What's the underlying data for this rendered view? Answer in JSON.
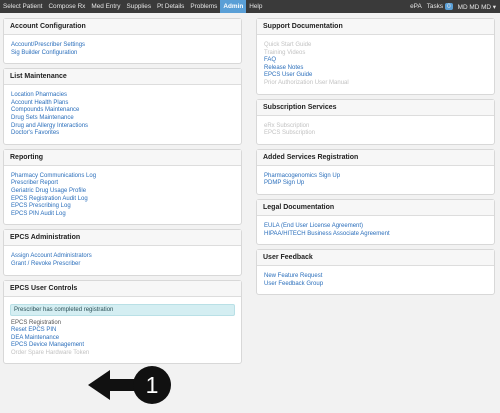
{
  "topnav": {
    "items": [
      {
        "label": "Select Patient",
        "active": false
      },
      {
        "label": "Compose Rx",
        "active": false
      },
      {
        "label": "Med Entry",
        "active": false
      },
      {
        "label": "Supplies",
        "active": false
      },
      {
        "label": "Pt Details",
        "active": false
      },
      {
        "label": "Problems",
        "active": false
      },
      {
        "label": "Admin",
        "active": true
      },
      {
        "label": "Help",
        "active": false
      }
    ],
    "epa": "ePA",
    "tasks_label": "Tasks",
    "tasks_count": "0",
    "user_menu": "MD MD MD ▾"
  },
  "left_panels": [
    {
      "title": "Account Configuration",
      "links": [
        {
          "label": "Account/Prescriber Settings",
          "state": "link"
        },
        {
          "label": "Sig Builder Configuration",
          "state": "link"
        }
      ]
    },
    {
      "title": "List Maintenance",
      "links": [
        {
          "label": "Location Pharmacies",
          "state": "link"
        },
        {
          "label": "Account Health Plans",
          "state": "link"
        },
        {
          "label": "Compounds Maintenance",
          "state": "link"
        },
        {
          "label": "Drug Sets Maintenance",
          "state": "link"
        },
        {
          "label": "Drug and Allergy Interactions",
          "state": "link"
        },
        {
          "label": "Doctor's Favorites",
          "state": "link"
        }
      ]
    },
    {
      "title": "Reporting",
      "links": [
        {
          "label": "Pharmacy Communications Log",
          "state": "link"
        },
        {
          "label": "Prescriber Report",
          "state": "link"
        },
        {
          "label": "Geriatric Drug Usage Profile",
          "state": "link"
        },
        {
          "label": "EPCS Registration Audit Log",
          "state": "link"
        },
        {
          "label": "EPCS Prescribing Log",
          "state": "link"
        },
        {
          "label": "EPCS PIN Audit Log",
          "state": "link"
        }
      ]
    },
    {
      "title": "EPCS Administration",
      "links": [
        {
          "label": "Assign Account Administrators",
          "state": "link"
        },
        {
          "label": "Grant / Revoke Prescriber",
          "state": "link"
        }
      ]
    },
    {
      "title": "EPCS User Controls",
      "notice": "Prescriber has completed registration",
      "links": [
        {
          "label": "EPCS Registration",
          "state": "plain"
        },
        {
          "label": "Reset EPCS PIN",
          "state": "link"
        },
        {
          "label": "DEA Maintenance",
          "state": "link"
        },
        {
          "label": "EPCS Device Management",
          "state": "link"
        },
        {
          "label": "Order Spare Hardware Token",
          "state": "muted"
        }
      ]
    }
  ],
  "right_panels": [
    {
      "title": "Support Documentation",
      "links": [
        {
          "label": "Quick Start Guide",
          "state": "muted"
        },
        {
          "label": "Training Videos",
          "state": "muted"
        },
        {
          "label": "FAQ",
          "state": "link"
        },
        {
          "label": "Release Notes",
          "state": "link"
        },
        {
          "label": "EPCS User Guide",
          "state": "link"
        },
        {
          "label": "Prior Authorization User Manual",
          "state": "muted"
        }
      ]
    },
    {
      "title": "Subscription Services",
      "links": [
        {
          "label": "eRx Subscription",
          "state": "muted"
        },
        {
          "label": "EPCS Subscription",
          "state": "muted"
        }
      ]
    },
    {
      "title": "Added Services Registration",
      "links": [
        {
          "label": "Pharmacogenomics Sign Up",
          "state": "link"
        },
        {
          "label": "PDMP Sign Up",
          "state": "link"
        }
      ]
    },
    {
      "title": "Legal Documentation",
      "links": [
        {
          "label": "EULA (End User License Agreement)",
          "state": "link"
        },
        {
          "label": "HIPAA/HITECH Business Associate Agreement",
          "state": "link"
        }
      ]
    },
    {
      "title": "User Feedback",
      "links": [
        {
          "label": "New Feature Request",
          "state": "link"
        },
        {
          "label": "User Feedback Group",
          "state": "link"
        }
      ]
    }
  ],
  "callout": {
    "number": "1",
    "colors": {
      "fill": "#111111",
      "text": "#ffffff"
    }
  }
}
